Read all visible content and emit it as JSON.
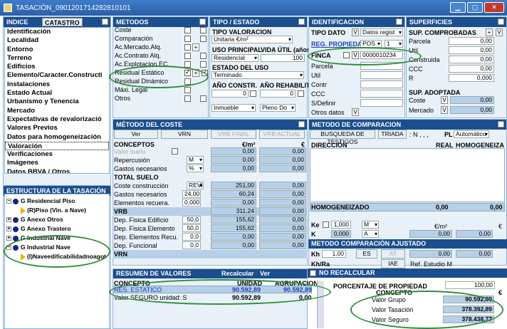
{
  "window": {
    "title": "TASACIÓN_0901201714282810101",
    "min": "▁",
    "max": "▢",
    "close": "✕"
  },
  "indice": {
    "title": "INDICE",
    "tab": "CATASTRO",
    "items": [
      "Identificación",
      "Localidad",
      "Entorno",
      "Terreno",
      "Edificios",
      "Elemento/Caracter.Constructi",
      "Instalaciones",
      "Estado Actual",
      "Urbanismo y Tenencia",
      "Mercado",
      "Expectativas de revalorizació",
      "Valores Previos",
      "Datos para homogeneización",
      "Valoración",
      "Verificaciones",
      "Imágenes",
      "Datos BBVA / Otros"
    ],
    "selected": "Valoración"
  },
  "estructura": {
    "title": "ESTRUCTURA DE LA TASACIÓN",
    "nodes": [
      "G Residencial Piso",
      "(R)Piso (Vin. a Nave)",
      "G Anexo Otros",
      "G Anexo Trastero",
      "G Industrial Nave",
      "G Industrial Nave",
      "(I)Naveedificabilidadnoagot"
    ]
  },
  "metodos": {
    "title": "METODOS",
    "items": [
      "Coste",
      "Comparación",
      "Ac.Mercado.Alq.",
      "Ac.Contrato Alq.",
      "Ac.Explotacion.EC",
      "Residual Estático",
      "Residual Dinámico",
      "Máxi. Legal",
      "Otros"
    ]
  },
  "tipo": {
    "title": "TIPO / ESTADO",
    "tipo_valoracion_label": "TIPO VALORACION",
    "tipo_valoracion": "Unitaria €/m²",
    "uso_label": "USO PRINCIPAL",
    "uso": "Residencial",
    "vida_label": "VIDA ÚTIL (años)",
    "vida": "100",
    "estado_label": "ESTADO DEL USO",
    "estado": "Terminado",
    "anio_constr_label": "AÑO CONSTR.",
    "anio_constr": "0",
    "anio_rehab_label": "AÑO REHABILITA",
    "anio_rehab": "0",
    "inmueble": "Inmueble",
    "pleno": "Pleno Do"
  },
  "identificacion": {
    "title": "IDENTIFICACION",
    "tipo_dato_label": "TIPO DATO",
    "tipo_dato": "Datos regist",
    "reg_label": "REG. PROPIEDAD",
    "pos": "POS",
    "pos_num": "1",
    "finca_label": "FINCA",
    "finca": "0000010234",
    "labels": [
      "Parcela",
      "Util",
      "Contr",
      "CCC",
      "S/Definir"
    ],
    "otros": "Otros datos",
    "v": "V"
  },
  "superficies": {
    "title": "SUPERFICIES",
    "comp_label": "SUP. COMPROBADAS",
    "rows": [
      {
        "l": "Parcela",
        "v": "0,00"
      },
      {
        "l": "Util",
        "v": "0,00"
      },
      {
        "l": "Construida",
        "v": "0,00"
      },
      {
        "l": "CCC",
        "v": "0,00"
      },
      {
        "l": "R",
        "v": "0,000"
      }
    ],
    "adopt_label": "SUP. ADOPTADA",
    "adopt": [
      {
        "l": "Coste",
        "v": "0,00"
      },
      {
        "l": "Mercado",
        "v": "0,00"
      }
    ]
  },
  "coste": {
    "title": "MÉTODO DEL COSTE",
    "btn_ver": "Ver",
    "btn_vrn": "VRN",
    "btn_vrb": "VRB FINAL",
    "btn_vrba": "VRB ACTUAL",
    "col_concepto": "CONCEPTOS",
    "col_m2": "€/m²",
    "col_eur": "€",
    "rows": [
      {
        "l": "Valor suelo",
        "u": "",
        "m2": "0,00",
        "e": "0,00"
      },
      {
        "l": "Repercusión",
        "u": "M",
        "m2": "0,00",
        "e": "0,00"
      },
      {
        "l": "Gastos necesarios",
        "u": "%",
        "m2": "0,00",
        "e": "0,00"
      },
      {
        "l": "TOTAL SUELO",
        "u": "",
        "m2": "",
        "e": ""
      },
      {
        "l": "Coste construcción",
        "u": "REVI",
        "m2": "251,00",
        "e": "0,00"
      },
      {
        "l": "Gastos necesarios",
        "u": "24,00",
        "m2": "60,24",
        "e": "0,00"
      },
      {
        "l": "Elementos recuera.",
        "u": "0,000",
        "m2": "0,00",
        "e": "0,00"
      },
      {
        "l": "VRB",
        "u": "",
        "m2": "311,24",
        "e": "0,00"
      },
      {
        "l": "Dep. Fisica Edificio",
        "u": "50,0",
        "m2": "155,62",
        "e": "0,00"
      },
      {
        "l": "Dep. Fisica Elemento",
        "u": "50,0",
        "m2": "155,62",
        "e": "0,00"
      },
      {
        "l": "Dep. Elementos Recu.",
        "u": "0,0",
        "m2": "0,00",
        "e": "0,00"
      },
      {
        "l": "Dep. Funcional",
        "u": "0,0",
        "m2": "0,00",
        "e": "0,00"
      },
      {
        "l": "VRN",
        "u": "",
        "m2": "",
        "e": ""
      }
    ]
  },
  "comparacion": {
    "title": "METODO DE COMPARACION",
    "busq": "BUSQUEDA DE TESTIGOS",
    "triada": "TRIADA",
    "n": ": N , , ,",
    "pl": "PL",
    "auto": "Automático",
    "col_dir": "DIRECCIÓN",
    "col_real": "REAL",
    "col_hom": "HOMOGENEIZA",
    "homog": "HOMOGENEIZADO",
    "homog_v1": "0,00",
    "homog_v2": "0,00",
    "ke": "Ke",
    "ke_v": "1,000",
    "m": "M",
    "k": "K",
    "k_v": "0,000",
    "a": "A",
    "eur_m2": "€/m²",
    "eur": "€",
    "v1": "0,00",
    "v2": "0,00"
  },
  "ajustado": {
    "title": "METODO COMPARACIÓN AJUSTADO",
    "kh": "Kh",
    "kh_v": "1,00",
    "es": "ES",
    "at": "AT",
    "kh_val": "0,00",
    "kh_e": "0,00",
    "khra": "Kh/Ra",
    "iae": "IAE",
    "ref": "Ref. Estudio M"
  },
  "resumen": {
    "title": "RESUMEN DE VALORES",
    "recalc": "Recalcular",
    "ver": "Ver Agrupacion",
    "norecalc": "NO RECALCULAR",
    "col_concepto": "CONCEPTO",
    "col_unidad": "UNIDAD",
    "col_agrup": "AGRUPACION",
    "row_concepto": "RES. ESTATICO",
    "row_unidad": "90.592,89",
    "row_agrup": "90.592,89",
    "seg_label": "Valor SEGURO unidad: S",
    "seg_unidad": "90.592,89",
    "seg_agrup": "0,00"
  },
  "valores": {
    "pct_label": "PORCENTAJE DE PROPIEDAD",
    "pct": "100,00",
    "concepto": "CONCEPTO",
    "eur": "€",
    "rows": [
      {
        "l": "Valor Grupo",
        "v": "90.592,89"
      },
      {
        "l": "Valor Tasación",
        "v": "378.392,89"
      },
      {
        "l": "Valor Seguro",
        "v": "378.438,77"
      }
    ]
  }
}
